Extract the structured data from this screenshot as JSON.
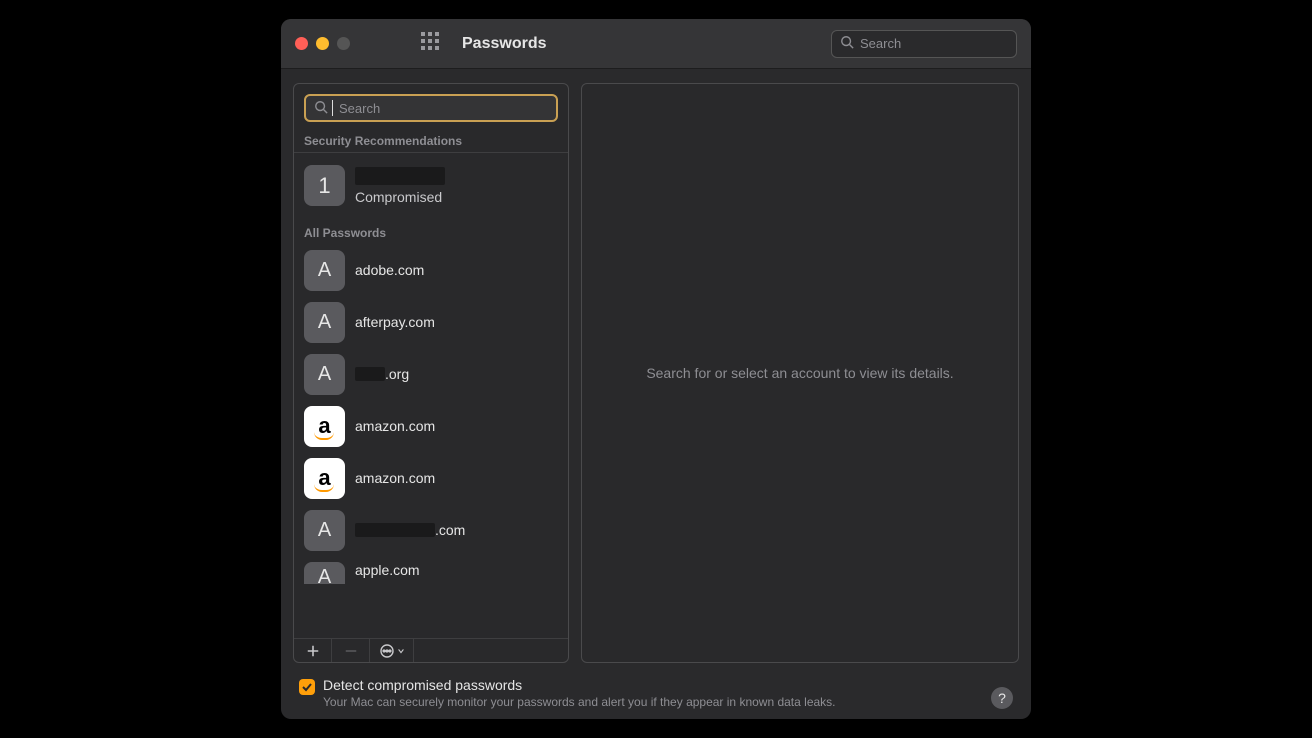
{
  "window": {
    "title": "Passwords"
  },
  "toolbar": {
    "search_placeholder": "Search"
  },
  "sidebar": {
    "search_placeholder": "Search",
    "section_recommendations": "Security Recommendations",
    "section_all": "All Passwords",
    "recommendation": {
      "count": "1",
      "status": "Compromised"
    },
    "items": [
      {
        "letter": "A",
        "label": "adobe.com",
        "icon": "letter"
      },
      {
        "letter": "A",
        "label": "afterpay.com",
        "icon": "letter"
      },
      {
        "letter": "A",
        "label_suffix": ".org",
        "redacted": true,
        "icon": "letter"
      },
      {
        "letter": "a",
        "label": "amazon.com",
        "icon": "amazon"
      },
      {
        "letter": "a",
        "label": "amazon.com",
        "icon": "amazon"
      },
      {
        "letter": "A",
        "label_suffix": ".com",
        "redacted": true,
        "icon": "letter"
      },
      {
        "letter": "A",
        "label": "apple.com",
        "partial": true,
        "icon": "letter"
      }
    ]
  },
  "detail": {
    "placeholder": "Search for or select an account to view its details."
  },
  "footer": {
    "checkbox_checked": true,
    "title": "Detect compromised passwords",
    "desc": "Your Mac can securely monitor your passwords and alert you if they appear in known data leaks.",
    "help": "?"
  },
  "colors": {
    "accent": "#ff9f0a",
    "focus_ring": "#c9a053"
  }
}
